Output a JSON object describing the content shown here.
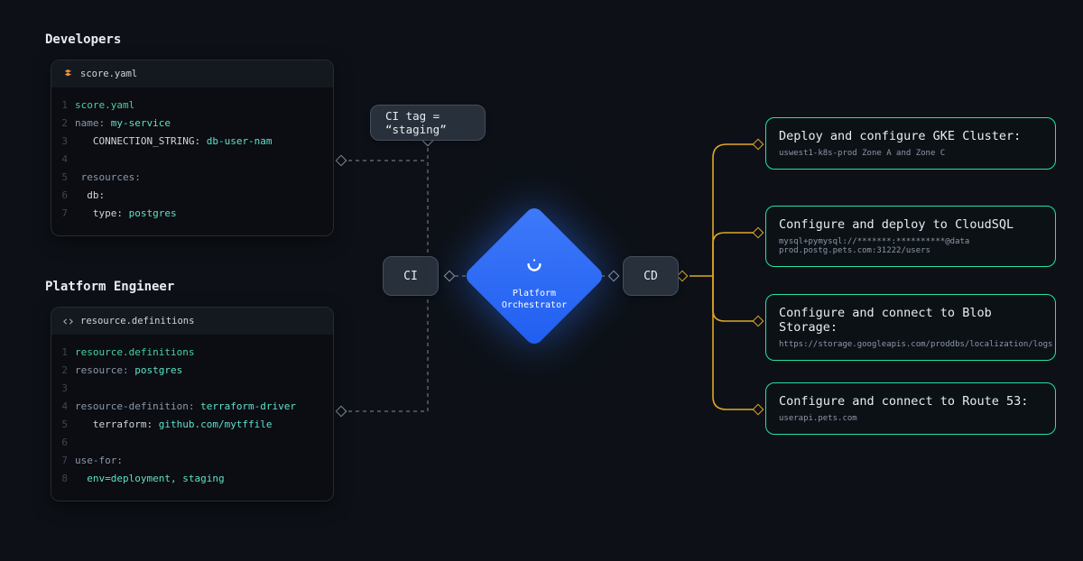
{
  "sections": {
    "dev": "Developers",
    "pe": "Platform Engineer"
  },
  "editor1": {
    "tab": "score.yaml",
    "lines": [
      {
        "n": "1",
        "h": "<span class='tk-g'>score.yaml</span>"
      },
      {
        "n": "2",
        "h": "<span class='tk-b'>name:</span> <span class='tk-c'>my-service</span>"
      },
      {
        "n": "3",
        "h": "   CONNECTION_STRING: <span class='tk-c'>db-user-nam</span>"
      },
      {
        "n": "4",
        "h": ""
      },
      {
        "n": "5",
        "h": " <span class='tk-b'>resources:</span>"
      },
      {
        "n": "6",
        "h": "  db:"
      },
      {
        "n": "7",
        "h": "   type: <span class='tk-c'>postgres</span>"
      }
    ]
  },
  "editor2": {
    "tab": "resource.definitions",
    "lines": [
      {
        "n": "1",
        "h": "<span class='tk-g'>resource.definitions</span>"
      },
      {
        "n": "2",
        "h": "<span class='tk-b'>resource:</span> <span class='tk-c'>postgres</span>"
      },
      {
        "n": "3",
        "h": ""
      },
      {
        "n": "4",
        "h": "<span class='tk-b'>resource-definition:</span> <span class='tk-c'>terraform-driver</span>"
      },
      {
        "n": "5",
        "h": "   terraform: <span class='tk-c'>github.com/mytffile</span>"
      },
      {
        "n": "6",
        "h": ""
      },
      {
        "n": "7",
        "h": "<span class='tk-b'>use-for:</span>"
      },
      {
        "n": "8",
        "h": "  <span class='tk-c'>env=deployment, staging</span>"
      }
    ]
  },
  "nodes": {
    "ciTag": "CI tag = “staging”",
    "ci": "CI",
    "cd": "CD",
    "orch": "Platform\nOrchestrator"
  },
  "outputs": [
    {
      "title": "Deploy and configure GKE Cluster:",
      "sub": "uswest1-k8s-prod Zone A and Zone C"
    },
    {
      "title": "Configure and deploy to CloudSQL",
      "sub": "mysql+pymysql://*******:**********@data prod.postg.pets.com:31222/users"
    },
    {
      "title": "Configure and connect to Blob Storage:",
      "sub": "https://storage.googleapis.com/proddbs/localization/logs"
    },
    {
      "title": "Configure and connect to Route 53:",
      "sub": "userapi.pets.com"
    }
  ]
}
